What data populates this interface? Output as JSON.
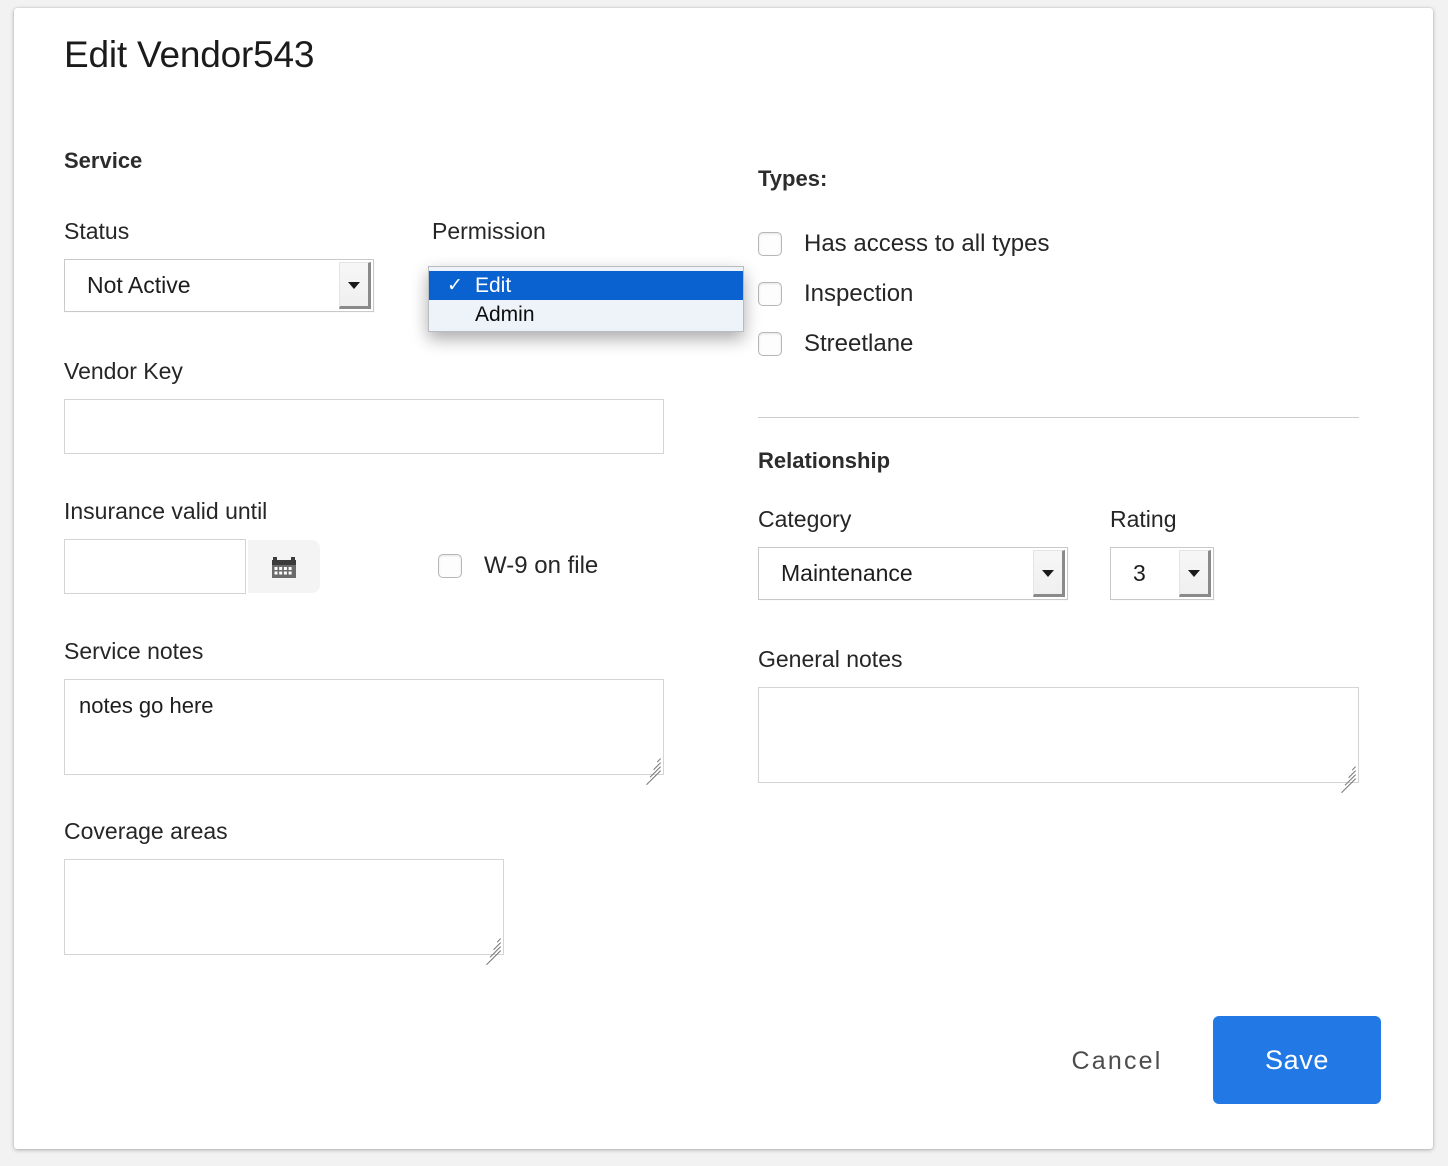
{
  "dialog": {
    "title": "Edit Vendor543"
  },
  "service": {
    "heading": "Service",
    "status": {
      "label": "Status",
      "value": "Not Active"
    },
    "permission": {
      "label": "Permission",
      "value": "Edit",
      "open": true,
      "options": [
        {
          "label": "Edit",
          "selected": true
        },
        {
          "label": "Admin",
          "selected": false
        }
      ]
    },
    "vendor_key": {
      "label": "Vendor Key",
      "value": "",
      "placeholder": ""
    },
    "insurance": {
      "label": "Insurance valid until",
      "value": "",
      "placeholder": "",
      "calendar_icon": "calendar-icon"
    },
    "w9": {
      "label": "W-9 on file",
      "checked": false
    },
    "service_notes": {
      "label": "Service notes",
      "value": "notes go here",
      "placeholder": ""
    },
    "coverage_areas": {
      "label": "Coverage areas",
      "value": "",
      "placeholder": ""
    }
  },
  "types": {
    "heading": "Types:",
    "items": [
      {
        "label": "Has access to all types",
        "checked": false
      },
      {
        "label": "Inspection",
        "checked": false
      },
      {
        "label": "Streetlane",
        "checked": false
      }
    ]
  },
  "relationship": {
    "heading": "Relationship",
    "category": {
      "label": "Category",
      "value": "Maintenance"
    },
    "rating": {
      "label": "Rating",
      "value": "3"
    },
    "general_notes": {
      "label": "General notes",
      "value": "",
      "placeholder": ""
    }
  },
  "footer": {
    "cancel_label": "Cancel",
    "save_label": "Save"
  },
  "colors": {
    "accent_blue": "#2279e6",
    "highlight_blue": "#0a62d0",
    "popup_bg": "#eef3fa",
    "dialog_bg": "#ffffff",
    "page_bg": "#f2f2f2",
    "divider": "#cccccc"
  }
}
